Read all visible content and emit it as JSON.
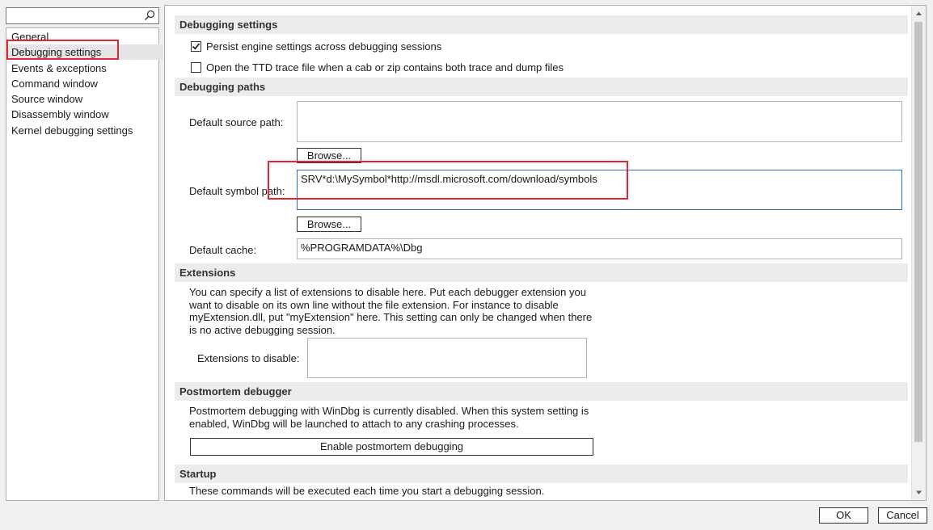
{
  "nav": {
    "search_placeholder": "",
    "items": [
      {
        "label": "General"
      },
      {
        "label": "Debugging settings"
      },
      {
        "label": "Events & exceptions"
      },
      {
        "label": "Command window"
      },
      {
        "label": "Source window"
      },
      {
        "label": "Disassembly window"
      },
      {
        "label": "Kernel debugging settings"
      }
    ],
    "selected": "Debugging settings"
  },
  "sections": {
    "debugging_settings": {
      "title": "Debugging settings",
      "persist_label": "Persist engine settings across debugging sessions",
      "persist_checked": true,
      "ttd_label": "Open the TTD trace file when a cab or zip contains both trace and dump files",
      "ttd_checked": false
    },
    "debugging_paths": {
      "title": "Debugging paths",
      "source_label": "Default source path:",
      "source_value": "",
      "browse1": "Browse...",
      "symbol_label": "Default symbol path:",
      "symbol_value": "SRV*d:\\MySymbol*http://msdl.microsoft.com/download/symbols",
      "browse2": "Browse...",
      "cache_label": "Default cache:",
      "cache_value": "%PROGRAMDATA%\\Dbg"
    },
    "extensions": {
      "title": "Extensions",
      "description": "You can specify a list of extensions to disable here. Put each debugger extension you want to disable on its own line without the file extension. For instance to disable myExtension.dll, put \"myExtension\" here. This setting can only be changed when there is no active debugging session.",
      "disable_label": "Extensions to disable:",
      "disable_value": ""
    },
    "postmortem": {
      "title": "Postmortem debugger",
      "description": "Postmortem debugging with WinDbg is currently disabled. When this system setting is enabled, WinDbg will be launched to attach to any crashing processes.",
      "button": "Enable postmortem debugging"
    },
    "startup": {
      "title": "Startup",
      "description": "These commands will be executed each time you start a debugging session."
    }
  },
  "footer": {
    "ok": "OK",
    "cancel": "Cancel"
  },
  "colors": {
    "highlight_box": "#e32636",
    "focus_border": "#1e73be"
  },
  "icons": {
    "search": "search-icon",
    "scroll_up": "chevron-up-icon",
    "scroll_down": "chevron-down-icon",
    "check": "checkmark-icon"
  }
}
